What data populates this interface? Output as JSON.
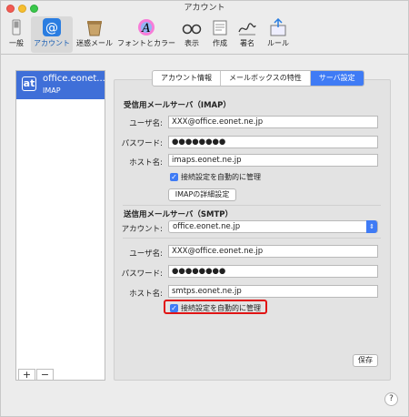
{
  "window": {
    "title": "アカウント"
  },
  "toolbar": {
    "items": [
      {
        "label": "一般",
        "icon": "switch-icon"
      },
      {
        "label": "アカウント",
        "icon": "at-sign-icon"
      },
      {
        "label": "迷惑メール",
        "icon": "junk-mail-icon"
      },
      {
        "label": "フォントとカラー",
        "icon": "font-color-icon"
      },
      {
        "label": "表示",
        "icon": "glasses-icon"
      },
      {
        "label": "作成",
        "icon": "compose-icon"
      },
      {
        "label": "署名",
        "icon": "signature-icon"
      },
      {
        "label": "ルール",
        "icon": "rules-icon"
      }
    ],
    "active_index": 1
  },
  "sidebar": {
    "account": {
      "name": "office.eonet...",
      "type": "IMAP",
      "icon": "at"
    },
    "add_label": "+",
    "remove_label": "−"
  },
  "tabs": {
    "items": [
      "アカウント情報",
      "メールボックスの特性",
      "サーバ設定"
    ],
    "selected": "サーバ設定"
  },
  "incoming": {
    "title": "受信用メールサーバ（IMAP）",
    "username_label": "ユーザ名:",
    "username": "XXX@office.eonet.ne.jp",
    "password_label": "パスワード:",
    "password": "●●●●●●●●",
    "host_label": "ホスト名:",
    "host": "imaps.eonet.ne.jp",
    "auto_manage": "接続設定を自動的に管理",
    "details_button": "IMAPの詳細設定"
  },
  "outgoing": {
    "title": "送信用メールサーバ（SMTP）",
    "account_label": "アカウント:",
    "account": "office.eonet.ne.jp",
    "username_label": "ユーザ名:",
    "username": "XXX@office.eonet.ne.jp",
    "password_label": "パスワード:",
    "password": "●●●●●●●●",
    "host_label": "ホスト名:",
    "host": "smtps.eonet.ne.jp",
    "auto_manage": "接続設定を自動的に管理"
  },
  "save_button": "保存",
  "help_button": "?",
  "colors": {
    "accent": "#3f7bf5",
    "highlight": "#e01414",
    "sidebar_selected": "#3f6fd8"
  }
}
